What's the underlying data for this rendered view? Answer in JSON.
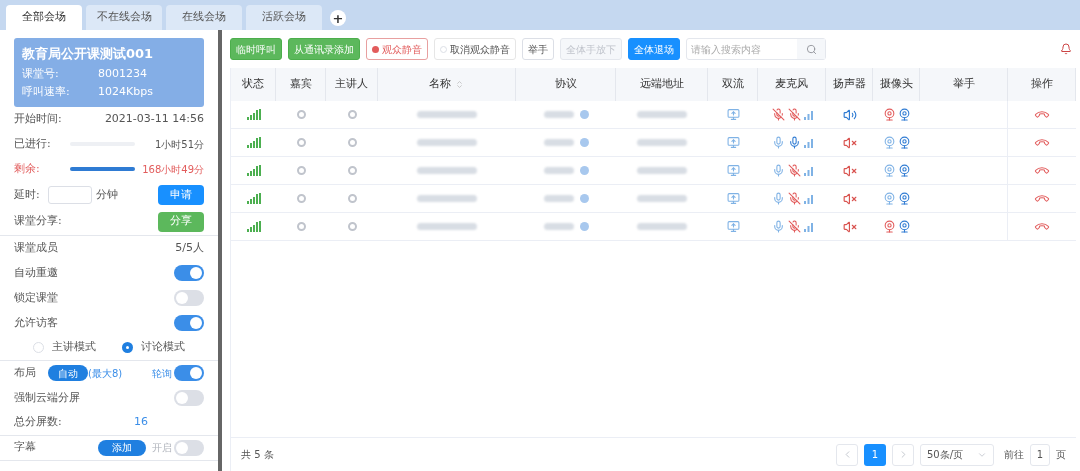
{
  "tabs": [
    {
      "label": "全部会场",
      "selected": true
    },
    {
      "label": "不在线会场",
      "selected": false
    },
    {
      "label": "在线会场",
      "selected": false
    },
    {
      "label": "活跃会场",
      "selected": false
    }
  ],
  "add_tab": "+",
  "classroom": {
    "title": "教育局公开课测试001",
    "fields": [
      {
        "label": "课堂号:",
        "value": "8001234"
      },
      {
        "label": "呼叫速率:",
        "value": "1024Kbps"
      }
    ]
  },
  "start_time": {
    "label": "开始时间:",
    "value": "2021-03-11 14:56"
  },
  "progress": [
    {
      "label": "已进行:",
      "level": 0,
      "reading": "1小时51分",
      "warning": false
    },
    {
      "label": "剩余:",
      "level": 1,
      "reading": "168小时49分",
      "warning": true
    }
  ],
  "extend": {
    "label": "延时:",
    "unit": "分钟",
    "button": "申请"
  },
  "share": {
    "label": "课堂分享:",
    "button": "分享"
  },
  "members": {
    "label": "课堂成员",
    "count": "5/5人"
  },
  "settings": [
    {
      "label": "自动重邀",
      "on": true
    },
    {
      "label": "锁定课堂",
      "on": false
    },
    {
      "label": "允许访客",
      "on": true
    }
  ],
  "modes": [
    {
      "label": "主讲模式",
      "selected": false
    },
    {
      "label": "讨论模式",
      "selected": true
    }
  ],
  "layout": {
    "label": "布局",
    "button": "自动",
    "note": "(最大8)",
    "poll_label": "轮询",
    "poll_on": true
  },
  "force_split": {
    "label": "强制云端分屏",
    "on": false
  },
  "total_screens": {
    "label": "总分屏数:",
    "value": "16"
  },
  "subtitle": {
    "label": "字幕",
    "button": "添加",
    "switch_label": "开启",
    "on": false
  },
  "toolbar": {
    "buttons": [
      {
        "label": "临时呼叫",
        "kind": "green"
      },
      {
        "label": "从通讯录添加",
        "kind": "green"
      },
      {
        "label": "观众静音",
        "kind": "radio-on"
      },
      {
        "label": "取消观众静音",
        "kind": "radio-off"
      },
      {
        "label": "举手",
        "kind": "plain"
      },
      {
        "label": "全体手放下",
        "kind": "disabled"
      },
      {
        "label": "全体退场",
        "kind": "blue"
      }
    ],
    "search": {
      "placeholder": "请输入搜索内容"
    }
  },
  "table": {
    "columns": [
      "状态",
      "嘉宾",
      "主讲人",
      "名称",
      "协议",
      "远端地址",
      "双流",
      "麦克风",
      "扬声器",
      "摄像头",
      "举手",
      "操作"
    ],
    "rows": [
      {
        "mic_local_muted": true,
        "mic_remote_muted": true,
        "speaker_muted": false,
        "camera_local_muted": true
      },
      {
        "mic_local_muted": false,
        "mic_remote_muted": false,
        "speaker_muted": true,
        "camera_local_muted": false
      },
      {
        "mic_local_muted": false,
        "mic_remote_muted": true,
        "speaker_muted": true,
        "camera_local_muted": false
      },
      {
        "mic_local_muted": false,
        "mic_remote_muted": true,
        "speaker_muted": true,
        "camera_local_muted": false
      },
      {
        "mic_local_muted": false,
        "mic_remote_muted": true,
        "speaker_muted": true,
        "camera_local_muted": true
      }
    ]
  },
  "footer": {
    "total": "共 5 条",
    "current_page": "1",
    "page_size": "50条/页",
    "goto_label": "前往",
    "goto_value": "1",
    "page_unit": "页"
  }
}
